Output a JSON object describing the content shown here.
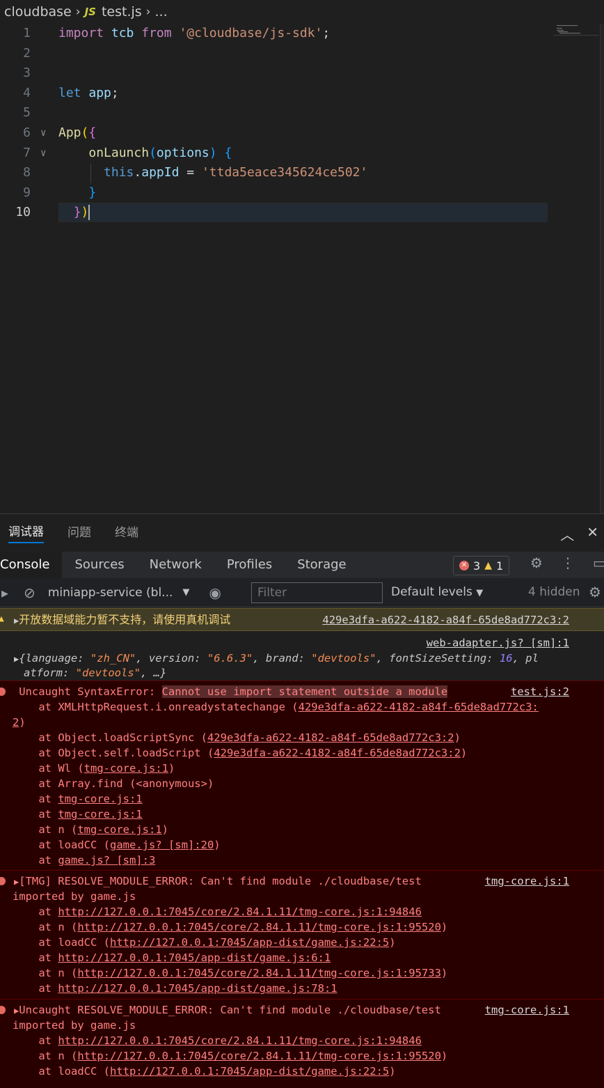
{
  "breadcrumb": {
    "folder": "cloudbase",
    "file_icon": "JS",
    "file": "test.js",
    "more": "..."
  },
  "editor": {
    "lines": [
      {
        "num": "1"
      },
      {
        "num": "2"
      },
      {
        "num": "3"
      },
      {
        "num": "4"
      },
      {
        "num": "5"
      },
      {
        "num": "6"
      },
      {
        "num": "7"
      },
      {
        "num": "8"
      },
      {
        "num": "9"
      },
      {
        "num": "10"
      }
    ],
    "code": {
      "l1_import": "import",
      "l1_tcb": "tcb",
      "l1_from": "from",
      "l1_str": "'@cloudbase/js-sdk'",
      "l1_semi": ";",
      "l4_let": "let",
      "l4_app": "app",
      "l4_semi": ";",
      "l6_app": "App",
      "l6_paren": "(",
      "l6_brace": "{",
      "l7_fn": "onLaunch",
      "l7_paren_open": "(",
      "l7_param": "options",
      "l7_paren_close": ")",
      "l7_brace": "{",
      "l8_this": "this",
      "l8_dot": ".",
      "l8_prop": "appId",
      "l8_eq": " = ",
      "l8_str": "'ttda5eace345624ce502'",
      "l9_brace": "}",
      "l10_brace": "}",
      "l10_paren": ")"
    }
  },
  "panel": {
    "tabs": [
      "调试器",
      "问题",
      "终端"
    ],
    "icons": {
      "collapse": "chevron-up-icon",
      "close": "close-icon"
    }
  },
  "devtools": {
    "tabs": [
      "Console",
      "Sources",
      "Network",
      "Profiles",
      "Storage"
    ],
    "error_count": "3",
    "warning_count": "1",
    "context": "miniapp-service (bl...",
    "filter_placeholder": "Filter",
    "levels": "Default levels",
    "hidden": "4 hidden"
  },
  "console": {
    "warn": {
      "text": "开放数据域能力暂不支持，请使用真机调试",
      "src": "429e3dfa-a622-4182-a84f-65de8ad772c3:2"
    },
    "info": {
      "src": "web-adapter.js? [sm]:1",
      "l1_open": "{",
      "k_language": "language",
      "v_language": "\"zh_CN\"",
      "k_version": "version",
      "v_version": "\"6.6.3\"",
      "k_brand": "brand",
      "v_brand": "\"devtools\"",
      "k_font": "fontSizeSetting",
      "v_font": "16",
      "k_pl": "pl",
      "k_atform": "atform",
      "v_platform": "\"devtools\"",
      "l2_tail": ", …}"
    },
    "err1": {
      "prefix": "Uncaught SyntaxError: ",
      "highlight": "Cannot use import statement outside a module",
      "src": "test.js:2",
      "l2a": "    at XMLHttpRequest.i.onreadystatechange (",
      "l2b": "429e3dfa-a622-4182-a84f-65de8ad772c3:",
      "l3": "2",
      "l3b": ")",
      "l4a": "    at Object.loadScriptSync (",
      "l4b": "429e3dfa-a622-4182-a84f-65de8ad772c3:2",
      "l4c": ")",
      "l5a": "    at Object.self.loadScript (",
      "l5b": "429e3dfa-a622-4182-a84f-65de8ad772c3:2",
      "l5c": ")",
      "l6a": "    at Wl (",
      "l6b": "tmg-core.js:1",
      "l6c": ")",
      "l7": "    at Array.find (<anonymous>)",
      "l8a": "    at ",
      "l8b": "tmg-core.js:1",
      "l9a": "    at ",
      "l9b": "tmg-core.js:1",
      "l10a": "    at n (",
      "l10b": "tmg-core.js:1",
      "l10c": ")",
      "l11a": "    at loadCC (",
      "l11b": "game.js? [sm]:20",
      "l11c": ")",
      "l12a": "    at ",
      "l12b": "game.js? [sm]:3"
    },
    "err2": {
      "l1": "[TMG] RESOLVE_MODULE_ERROR: Can't find module ./cloudbase/test",
      "src": "tmg-core.js:1",
      "l2": "imported by game.js",
      "l3a": "    at ",
      "l3b": "http://127.0.0.1:7045/core/2.84.1.11/tmg-core.js:1:94846",
      "l4a": "    at n (",
      "l4b": "http://127.0.0.1:7045/core/2.84.1.11/tmg-core.js:1:95520",
      "l4c": ")",
      "l5a": "    at loadCC (",
      "l5b": "http://127.0.0.1:7045/app-dist/game.js:22:5",
      "l5c": ")",
      "l6a": "    at ",
      "l6b": "http://127.0.0.1:7045/app-dist/game.js:6:1",
      "l7a": "    at n (",
      "l7b": "http://127.0.0.1:7045/core/2.84.1.11/tmg-core.js:1:95733",
      "l7c": ")",
      "l8a": "    at ",
      "l8b": "http://127.0.0.1:7045/app-dist/game.js:78:1"
    },
    "err3": {
      "l1": "Uncaught RESOLVE_MODULE_ERROR: Can't find module ./cloudbase/test",
      "src": "tmg-core.js:1",
      "l2": "imported by game.js",
      "l3a": "    at ",
      "l3b": "http://127.0.0.1:7045/core/2.84.1.11/tmg-core.js:1:94846",
      "l4a": "    at n (",
      "l4b": "http://127.0.0.1:7045/core/2.84.1.11/tmg-core.js:1:95520",
      "l4c": ")",
      "l5a": "    at loadCC (",
      "l5b": "http://127.0.0.1:7045/app-dist/game.js:22:5",
      "l5c": ")"
    }
  },
  "colors": {
    "accent": "#0078d4",
    "error_bg": "#290000",
    "warn_bg": "#413c26",
    "error_text": "#ff8080"
  }
}
